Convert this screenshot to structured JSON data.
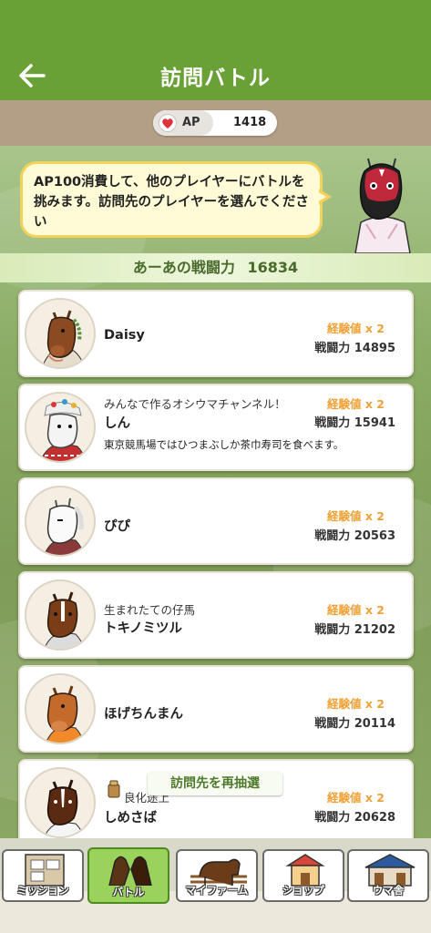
{
  "header": {
    "title": "訪問バトル",
    "back_icon": "arrow-left-icon",
    "color": "#6aa137"
  },
  "ap": {
    "icon": "heart-icon",
    "label": "AP",
    "value": "1418"
  },
  "bubble": {
    "text": "AP100消費して、他のプレイヤーにバトルを挑みます。訪問先のプレイヤーを選んでください"
  },
  "power_banner": {
    "label": "あーあの戦闘力",
    "value": "16834"
  },
  "players": [
    {
      "comment": "",
      "name": "Daisy",
      "exp": "経験値 x 2",
      "power_label": "戦闘力",
      "power": "14895",
      "extra": ""
    },
    {
      "comment": "みんなで作るオシウマチャンネル！",
      "name": "しん",
      "exp": "経験値 x 2",
      "power_label": "戦闘力",
      "power": "15941",
      "extra": "東京競馬場ではひつまぶしか茶巾寿司を食べます。"
    },
    {
      "comment": "",
      "name": "ぴぴ",
      "exp": "経験値 x 2",
      "power_label": "戦闘力",
      "power": "20563",
      "extra": ""
    },
    {
      "comment": "生まれたての仔馬",
      "name": "トキノミツル",
      "exp": "経験値 x 2",
      "power_label": "戦闘力",
      "power": "21202",
      "extra": ""
    },
    {
      "comment": "",
      "name": "ほげちんまん",
      "exp": "経験値 x 2",
      "power_label": "戦闘力",
      "power": "20114",
      "extra": ""
    },
    {
      "comment": "良化途上",
      "name": "しめさば",
      "exp": "経験値 x 2",
      "power_label": "戦闘力",
      "power": "20628",
      "extra": ""
    }
  ],
  "redraw_button": "訪問先を再抽選",
  "nav": {
    "items": [
      {
        "label": "ミッション",
        "icon": "mission-board-icon"
      },
      {
        "label": "バトル",
        "icon": "battle-horses-icon"
      },
      {
        "label": "マイファーム",
        "icon": "farm-horse-icon"
      },
      {
        "label": "ショップ",
        "icon": "shop-icon"
      },
      {
        "label": "ウマ舎",
        "icon": "stable-icon"
      }
    ],
    "active_color": "#9ad25b"
  }
}
